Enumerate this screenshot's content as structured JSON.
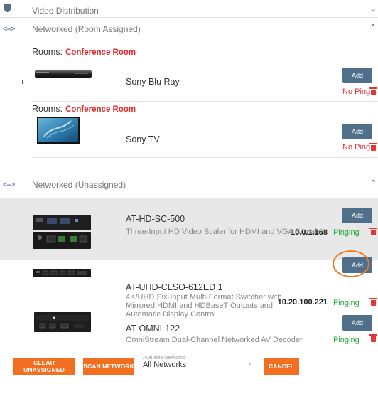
{
  "sections": {
    "video_distribution": {
      "title": "Video Distribution"
    },
    "networked_room_assigned": {
      "icon": "<-->",
      "title": "Networked (Room Assigned)"
    },
    "networked_unassigned": {
      "icon": "<-->",
      "title": "Networked (Unassigned)"
    }
  },
  "assigned_devices": [
    {
      "rooms_label": "Rooms:",
      "room": "Conference Room",
      "name": "Sony Blu Ray",
      "add_label": "Add",
      "status": "No Ping",
      "thumb_icon": "blu-ray-player-image"
    },
    {
      "rooms_label": "Rooms:",
      "room": "Conference Room",
      "name": "Sony TV",
      "add_label": "Add",
      "status": "No Ping",
      "thumb_icon": "tv-display-image"
    }
  ],
  "unassigned_devices": [
    {
      "name": "AT-HD-SC-500",
      "description": "Three-Input HD Video Scaler for HDMI and VGA Signals",
      "ip": "10.0.1.168",
      "add_label": "Add",
      "status": "Pinging",
      "thumb_icon": "video-scaler-image"
    },
    {
      "name": "AT-UHD-CLSO-612ED 1",
      "description": "4K/UHD Six-Input Multi-Format Switcher with Mirrored HDMI and HDBaseT Outputs and Automatic Display Control",
      "ip": "10.20.100.221",
      "add_label": "Add",
      "status": "Pinging",
      "thumb_icon": "switcher-image"
    },
    {
      "name": "AT-OMNI-122",
      "description": "OmniStream Dual-Channel Networked AV Decoder",
      "ip": "",
      "add_label": "Add",
      "status": "Pinging",
      "thumb_icon": "decoder-image"
    }
  ],
  "footer": {
    "clear_label": "CLEAR UNASSIGNED",
    "scan_label": "SCAN NETWORK",
    "networks_label": "Available Networks",
    "networks_value": "All Networks",
    "cancel_label": "CANCEL"
  },
  "colors": {
    "accent": "#f26f21",
    "add_button": "#4f6f8a",
    "no_ping": "#e8282b",
    "pinging": "#2aa844",
    "room": "#e8282b"
  }
}
